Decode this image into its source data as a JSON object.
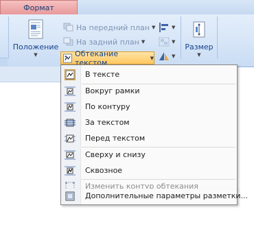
{
  "ribbon": {
    "active_tab": "Формат",
    "position_label": "Положение",
    "bring_front_label": "На передний план",
    "send_back_label": "На задний план",
    "wrap_label": "Обтекание текстом",
    "size_label": "Размер"
  },
  "menu": {
    "items": [
      {
        "label": "В тексте",
        "icon": "inline-wrap-icon",
        "checked": true,
        "disabled": false
      },
      {
        "label": "Вокруг рамки",
        "icon": "square-wrap-icon",
        "checked": false,
        "disabled": false
      },
      {
        "label": "По контуру",
        "icon": "tight-wrap-icon",
        "checked": false,
        "disabled": false
      },
      {
        "label": "За текстом",
        "icon": "behind-text-icon",
        "checked": false,
        "disabled": false
      },
      {
        "label": "Перед текстом",
        "icon": "front-text-icon",
        "checked": false,
        "disabled": false
      },
      {
        "label": "Сверху и снизу",
        "icon": "top-bottom-wrap-icon",
        "checked": false,
        "disabled": false
      },
      {
        "label": "Сквозное",
        "icon": "through-wrap-icon",
        "checked": false,
        "disabled": false
      },
      {
        "label": "Изменить контур обтекания",
        "icon": "edit-wrap-points-icon",
        "checked": false,
        "disabled": true
      },
      {
        "label": "Дополнительные параметры разметки...",
        "icon": "more-layout-options-icon",
        "checked": false,
        "disabled": false
      }
    ]
  },
  "colors": {
    "accent_orange": "#ffc760",
    "ribbon_blue": "#d6e5f7",
    "tab_red": "#e79a9a"
  }
}
